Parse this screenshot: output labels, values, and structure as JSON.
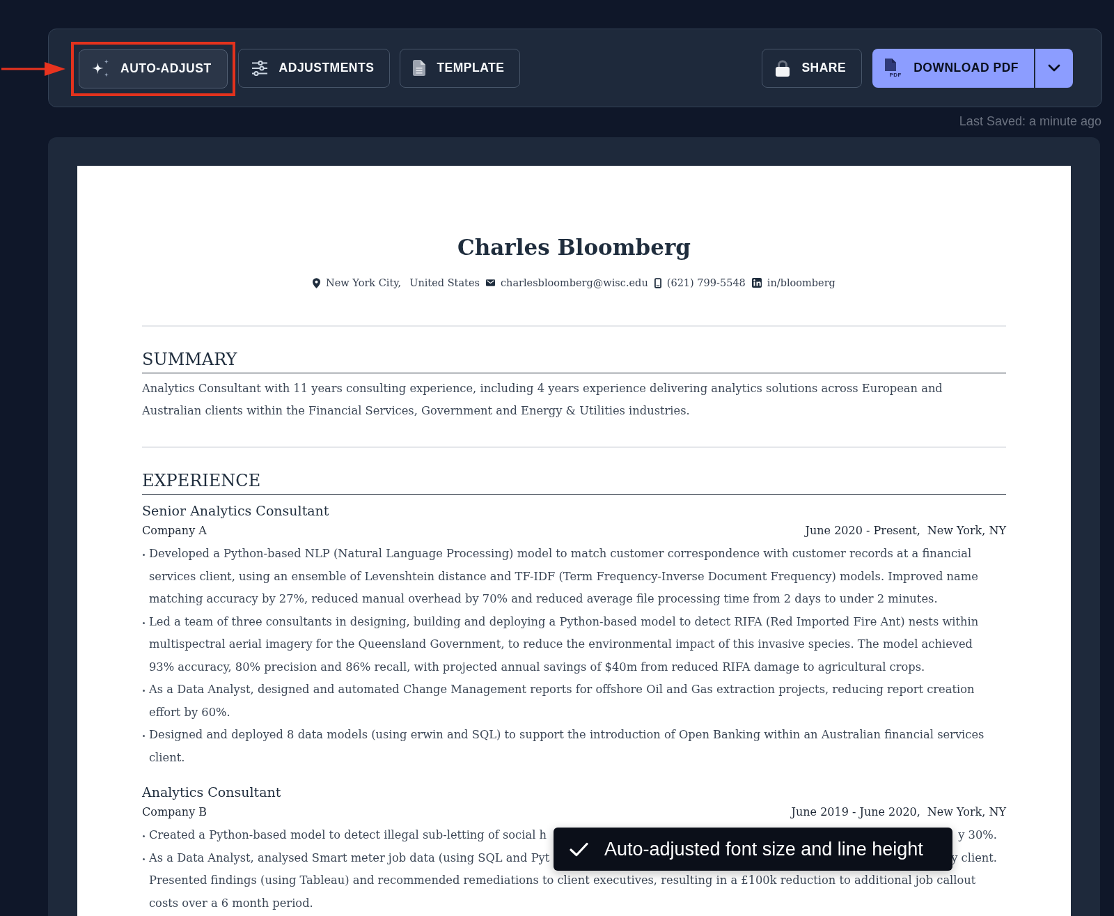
{
  "toolbar": {
    "buttons": [
      {
        "kind": "auto",
        "label": "AUTO-ADJUST",
        "active": true,
        "highlighted": true
      },
      {
        "kind": "adjustments",
        "label": "ADJUSTMENTS",
        "active": false,
        "highlighted": false
      },
      {
        "kind": "template",
        "label": "TEMPLATE",
        "active": false,
        "highlighted": false
      },
      {
        "kind": "share",
        "label": "SHARE",
        "active": false,
        "highlighted": false
      },
      {
        "kind": "download",
        "label": "DOWNLOAD PDF",
        "icon_label": "PDF",
        "active": false,
        "highlighted": false
      }
    ]
  },
  "last_saved": "Last Saved: a minute ago",
  "resume": {
    "name": "Charles Bloomberg",
    "contact": [
      {
        "kind": "location",
        "parts": [
          "New York City,",
          "United States"
        ]
      },
      {
        "kind": "email",
        "parts": [
          "charlesbloomberg@wisc.edu"
        ]
      },
      {
        "kind": "phone",
        "parts": [
          "(621) 799-5548"
        ]
      },
      {
        "kind": "linkedin",
        "parts": [
          "in/bloomberg"
        ]
      }
    ],
    "sections": [
      {
        "kind": "summary",
        "heading": "SUMMARY",
        "text": "Analytics Consultant with 11 years consulting experience, including 4 years experience delivering analytics solutions across European and Australian clients within the Financial Services, Government and Energy & Utilities industries."
      },
      {
        "kind": "experience",
        "heading": "EXPERIENCE",
        "jobs": [
          {
            "title": "Senior Analytics Consultant",
            "company": "Company A",
            "dates": "June 2020 - Present,",
            "location": "New York, NY",
            "bullets": [
              {
                "kind": "text",
                "text": "Developed a Python-based NLP (Natural Language Processing) model to match customer correspondence with customer records at a financial services client, using an ensemble of Levenshtein distance and TF-IDF (Term Frequency-Inverse Document Frequency) models. Improved name matching accuracy by 27%, reduced manual overhead by 70% and reduced average file processing time from 2 days to under 2 minutes."
              },
              {
                "kind": "text",
                "text": "Led a team of three consultants in designing, building and deploying a Python-based model to detect RIFA (Red Imported Fire Ant) nests within multispectral aerial imagery for the Queensland Government, to reduce the environmental impact of this invasive species. The model achieved 93% accuracy, 80% precision and 86% recall, with projected annual savings of $40m from reduced RIFA damage to agricultural crops."
              },
              {
                "kind": "text",
                "text": "As a Data Analyst, designed and automated Change Management reports for offshore Oil and Gas extraction projects, reducing report creation effort by 60%."
              },
              {
                "kind": "text",
                "text": "Designed and deployed 8 data models (using erwin and SQL) to support the introduction of Open Banking within an Australian financial services client."
              }
            ]
          },
          {
            "title": "Analytics Consultant",
            "company": "Company B",
            "dates": "June 2019 - June 2020,",
            "location": "New York, NY",
            "bullets": [
              {
                "kind": "covered",
                "visible_start": "Created a Python-based model to detect illegal sub-letting of social h",
                "visible_end": "y 30%."
              },
              {
                "kind": "covered",
                "visible_start": "As a Data Analyst, analysed Smart meter job data (using SQL and Pyt",
                "visible_end": "y client.",
                "continuation": "Presented findings (using Tableau) and recommended remediations to client executives, resulting in a £100k reduction to additional job callout costs over a 6 month period."
              }
            ]
          }
        ]
      }
    ]
  },
  "toast": {
    "message": "Auto-adjusted font size and line height"
  }
}
